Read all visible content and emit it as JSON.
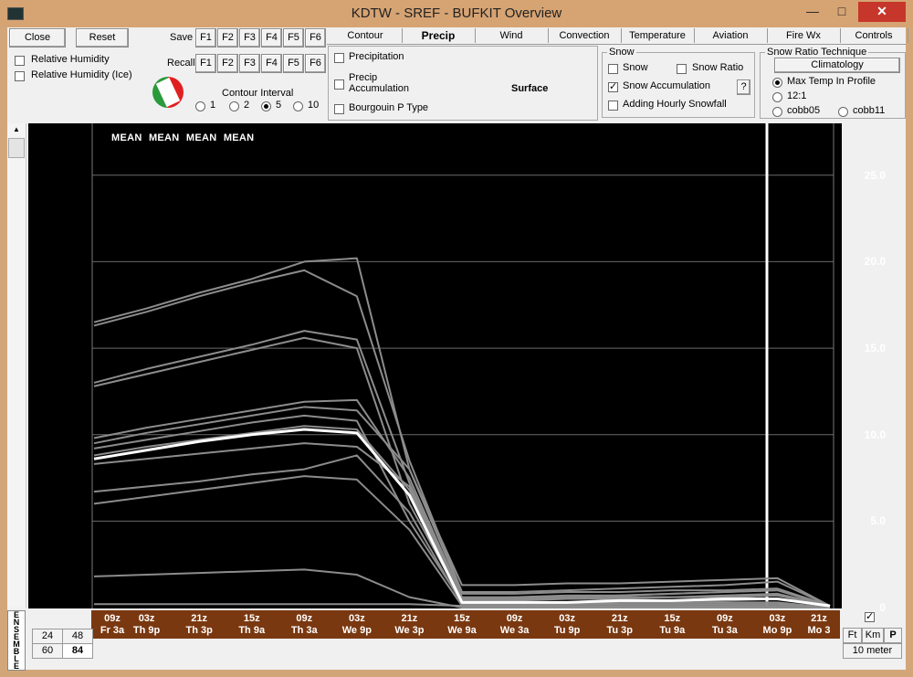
{
  "window": {
    "title": "KDTW - SREF - BUFKIT Overview",
    "min": "—",
    "max": "□",
    "close": "✕"
  },
  "top_left": {
    "close_label": "Close",
    "reset_label": "Reset",
    "save_label": "Save",
    "recall_label": "Recall",
    "f_keys": [
      "F1",
      "F2",
      "F3",
      "F4",
      "F5",
      "F6"
    ],
    "rh_label": "Relative Humidity",
    "rh_ice_label": "Relative Humidity (Ice)",
    "contour_label": "Contour Interval",
    "contour_options": [
      "1",
      "2",
      "5",
      "10"
    ],
    "contour_selected": "5"
  },
  "tabs": [
    "Contour",
    "Precip",
    "Wind",
    "Convection",
    "Temperature",
    "Aviation",
    "Fire Wx",
    "Controls"
  ],
  "active_tab": "Precip",
  "precip_panel": {
    "precipitation": "Precipitation",
    "precip_accum_1": "Precip",
    "precip_accum_2": "Accumulation",
    "bourgouin": "Bourgouin P Type",
    "surface": "Surface"
  },
  "snow_group": {
    "title": "Snow",
    "snow": "Snow",
    "snow_ratio": "Snow Ratio",
    "snow_accum": "Snow Accumulation",
    "help": "?",
    "adding_hourly": "Adding Hourly Snowfall"
  },
  "snow_ratio_group": {
    "title": "Snow Ratio Technique",
    "climatology": "Climatology",
    "max_temp": "Max Temp In Profile",
    "r12": "12:1",
    "cobb05": "cobb05",
    "cobb11": "cobb11"
  },
  "plot_header": "MEAN MEAN MEAN MEAN",
  "y_ticks": [
    "25.0",
    "20.0",
    "15.0",
    "10.0",
    "5.0",
    "0"
  ],
  "time_labels": [
    {
      "h": "09z",
      "d": "Fr 3a"
    },
    {
      "h": "03z",
      "d": "Th 9p"
    },
    {
      "h": "21z",
      "d": "Th 3p"
    },
    {
      "h": "15z",
      "d": "Th 9a"
    },
    {
      "h": "09z",
      "d": "Th 3a"
    },
    {
      "h": "03z",
      "d": "We 9p"
    },
    {
      "h": "21z",
      "d": "We 3p"
    },
    {
      "h": "15z",
      "d": "We 9a"
    },
    {
      "h": "09z",
      "d": "We 3a"
    },
    {
      "h": "03z",
      "d": "Tu 9p"
    },
    {
      "h": "21z",
      "d": "Tu 3p"
    },
    {
      "h": "15z",
      "d": "Tu 9a"
    },
    {
      "h": "09z",
      "d": "Tu 3a"
    },
    {
      "h": "03z",
      "d": "Mo 9p"
    },
    {
      "h": "21z",
      "d": "Mo 3"
    }
  ],
  "bottom": {
    "ensemble": "ENSEMBLE",
    "hours": [
      "24",
      "48",
      "60",
      "84"
    ],
    "hours_selected": "84",
    "ft": "Ft",
    "km": "Km",
    "p": "P",
    "level": "10 meter"
  },
  "colors": {
    "mean_line": "#ffffff",
    "member_line": "#8c8c8c",
    "timebar": "#7a3810"
  },
  "chart_data": {
    "type": "line",
    "title": "MEAN MEAN MEAN MEAN",
    "xlabel": "",
    "ylabel": "",
    "ylim": [
      0,
      28
    ],
    "x": [
      "Fr 3a",
      "Th 9p",
      "Th 3p",
      "Th 9a",
      "Th 3a",
      "We 9p",
      "We 3p",
      "We 9a",
      "We 3a",
      "Tu 9p",
      "Tu 3p",
      "Tu 9a",
      "Tu 3a",
      "Mo 9p",
      "Mo 3"
    ],
    "series": [
      {
        "role": "mean",
        "values": [
          8.6,
          9.1,
          9.6,
          10.0,
          10.3,
          10.1,
          6.5,
          0.3,
          0.3,
          0.3,
          0.4,
          0.4,
          0.5,
          0.5,
          0.1
        ]
      },
      {
        "values": [
          16.5,
          17.3,
          18.2,
          19.0,
          20.0,
          20.2,
          8.0,
          1.3,
          1.3,
          1.4,
          1.4,
          1.5,
          1.6,
          1.7,
          0.1
        ]
      },
      {
        "values": [
          16.3,
          17.1,
          18.0,
          18.8,
          19.5,
          18.0,
          8.5,
          0.9,
          0.9,
          1.0,
          1.1,
          1.2,
          1.3,
          1.5,
          0.1
        ]
      },
      {
        "values": [
          13.0,
          13.8,
          14.5,
          15.2,
          16.0,
          15.5,
          7.2,
          0.5,
          0.6,
          0.6,
          0.7,
          0.8,
          0.9,
          1.0,
          0.1
        ]
      },
      {
        "values": [
          12.8,
          13.5,
          14.2,
          14.9,
          15.6,
          15.0,
          6.0,
          0.4,
          0.4,
          0.5,
          0.5,
          0.6,
          0.7,
          0.8,
          0.1
        ]
      },
      {
        "values": [
          9.8,
          10.4,
          10.9,
          11.4,
          11.9,
          12.0,
          7.5,
          0.6,
          0.6,
          0.7,
          0.7,
          0.8,
          0.9,
          1.0,
          0.1
        ]
      },
      {
        "values": [
          9.5,
          10.1,
          10.6,
          11.1,
          11.6,
          11.4,
          8.0,
          0.8,
          0.8,
          0.9,
          0.9,
          1.0,
          1.0,
          1.1,
          0.1
        ]
      },
      {
        "values": [
          9.2,
          9.7,
          10.2,
          10.7,
          11.1,
          10.8,
          5.0,
          0.3,
          0.3,
          0.3,
          0.4,
          0.4,
          0.4,
          0.5,
          0.1
        ]
      },
      {
        "values": [
          8.8,
          9.3,
          9.7,
          10.1,
          10.5,
          10.3,
          6.8,
          0.5,
          0.5,
          0.5,
          0.6,
          0.6,
          0.6,
          0.7,
          0.1
        ]
      },
      {
        "values": [
          8.3,
          8.6,
          8.9,
          9.2,
          9.5,
          9.3,
          7.0,
          0.5,
          0.5,
          0.5,
          0.6,
          0.6,
          0.6,
          0.7,
          0.1
        ]
      },
      {
        "values": [
          6.7,
          7.0,
          7.3,
          7.7,
          8.0,
          8.8,
          5.5,
          0.2,
          0.2,
          0.2,
          0.3,
          0.3,
          0.3,
          0.3,
          0.0
        ]
      },
      {
        "values": [
          6.0,
          6.4,
          6.8,
          7.2,
          7.6,
          7.4,
          4.5,
          0.1,
          0.1,
          0.2,
          0.2,
          0.2,
          0.2,
          0.2,
          0.0
        ]
      },
      {
        "values": [
          1.8,
          1.9,
          2.0,
          2.1,
          2.2,
          1.9,
          0.6,
          0.0,
          0.0,
          0.0,
          0.0,
          0.0,
          0.0,
          0.0,
          0.0
        ]
      },
      {
        "values": [
          0.2,
          0.2,
          0.2,
          0.2,
          0.2,
          0.2,
          0.2,
          0.1,
          0.1,
          0.1,
          0.1,
          0.1,
          0.1,
          0.1,
          0.0
        ]
      }
    ]
  }
}
